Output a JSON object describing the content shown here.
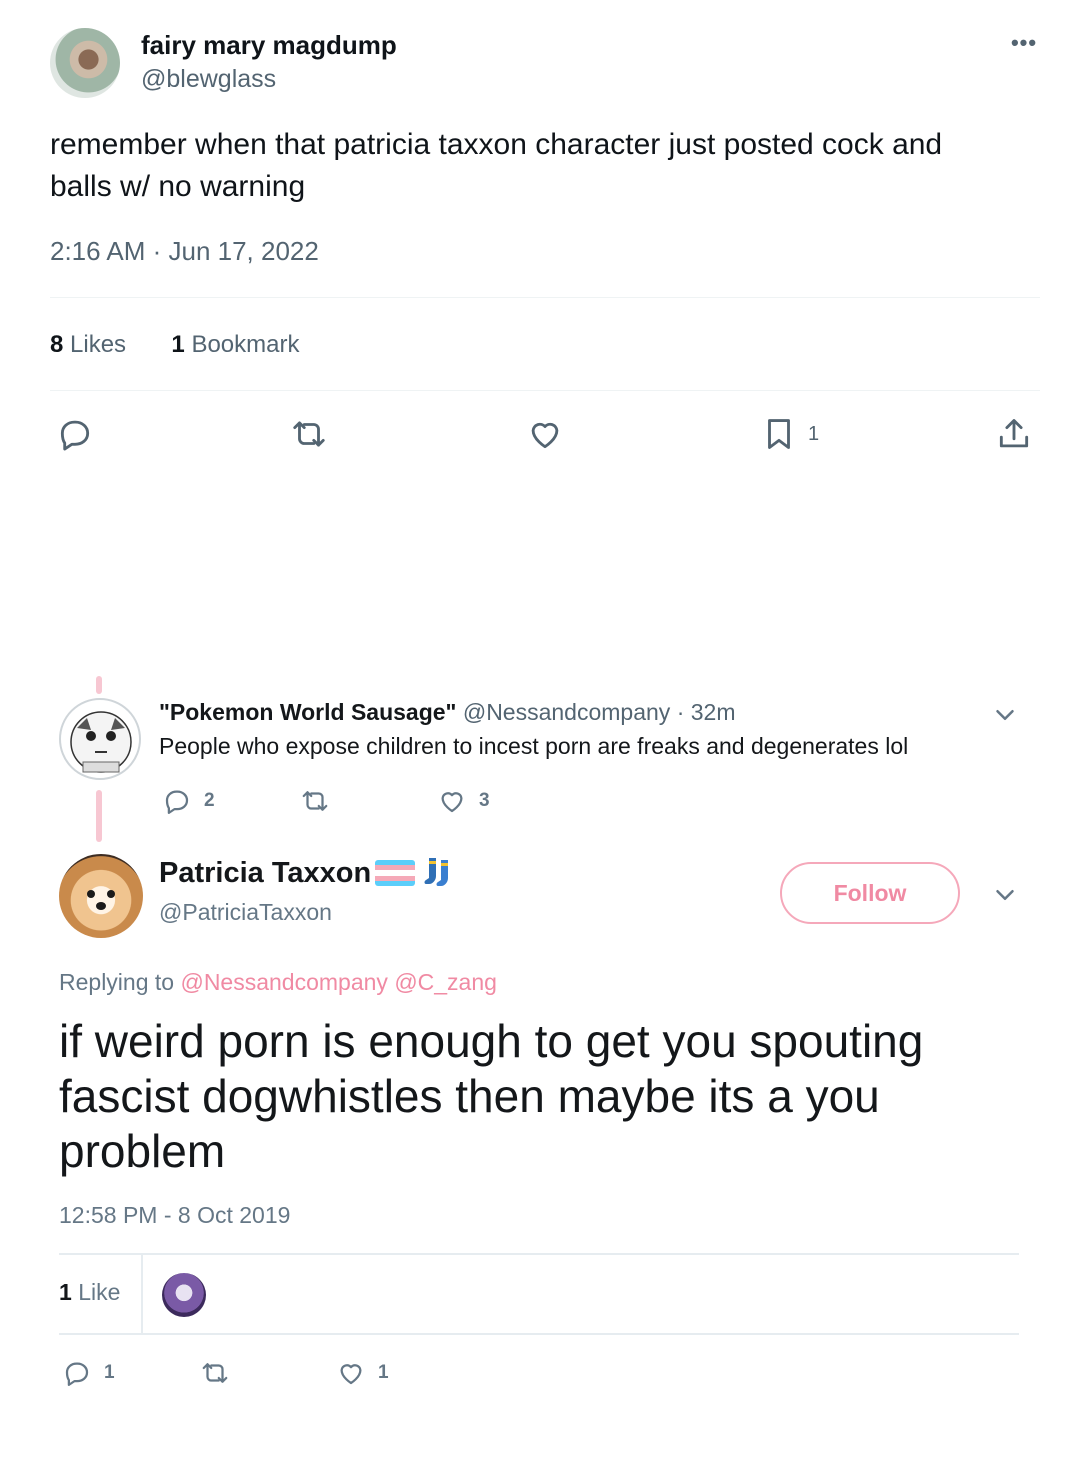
{
  "tweet1": {
    "display_name": "fairy mary magdump",
    "handle": "@blewglass",
    "more_icon": "more-icon",
    "text": "remember when that patricia taxxon character just posted cock and balls w/ no warning",
    "timestamp": "2:16 AM · Jun 17, 2022",
    "likes_count": "8",
    "likes_label": "Likes",
    "bookmarks_count": "1",
    "bookmarks_label": "Bookmark",
    "actions": {
      "reply_icon": "reply-icon",
      "retweet_icon": "retweet-icon",
      "like_icon": "heart-icon",
      "bookmark_icon": "bookmark-icon",
      "bookmark_count": "1",
      "share_icon": "share-icon"
    }
  },
  "reply_tweet": {
    "display_name": "\"Pokemon World Sausage\"",
    "handle": "@Nessandcompany",
    "separator": "·",
    "age": "32m",
    "text": "People who expose children to incest porn are freaks and degenerates lol",
    "reply_count": "2",
    "like_count": "3"
  },
  "main_tweet": {
    "display_name": "Patricia Taxxon",
    "handle": "@PatriciaTaxxon",
    "follow_label": "Follow",
    "replying_label": "Replying to",
    "mention1": "@Nessandcompany",
    "mention2": "@C_zang",
    "text": "if weird porn is enough to get you spouting fascist dogwhistles then maybe its a you problem",
    "timestamp": "12:58 PM - 8 Oct 2019",
    "likes_count": "1",
    "likes_label": "Like",
    "reply_count": "1",
    "like_count": "1",
    "flag_colors": [
      "#5bcefa",
      "#f5a9b8",
      "#ffffff",
      "#f5a9b8",
      "#5bcefa"
    ],
    "accent_color": "#f08aa3"
  }
}
